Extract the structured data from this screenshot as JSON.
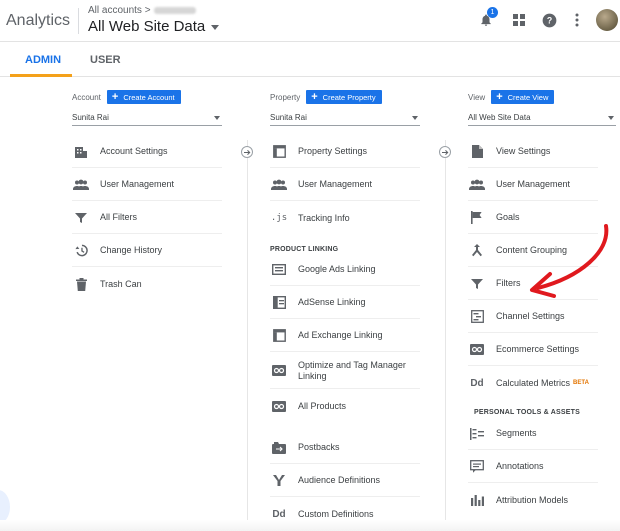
{
  "header": {
    "app_title": "Analytics",
    "breadcrumb": "All accounts >",
    "site_title": "All Web Site Data",
    "notification_count": "1"
  },
  "tabs": [
    {
      "label": "ADMIN",
      "active": true
    },
    {
      "label": "USER",
      "active": false
    }
  ],
  "columns": {
    "account": {
      "label": "Account",
      "create_label": "Create Account",
      "selected": "Sunita Rai",
      "items": [
        {
          "label": "Account Settings",
          "icon": "building-icon"
        },
        {
          "label": "User Management",
          "icon": "users-icon"
        },
        {
          "label": "All Filters",
          "icon": "filter-icon"
        },
        {
          "label": "Change History",
          "icon": "history-icon"
        },
        {
          "label": "Trash Can",
          "icon": "trash-icon"
        }
      ]
    },
    "property": {
      "label": "Property",
      "create_label": "Create Property",
      "selected": "Sunita Rai",
      "items": [
        {
          "label": "Property Settings",
          "icon": "window-icon"
        },
        {
          "label": "User Management",
          "icon": "users-icon"
        },
        {
          "label": "Tracking Info",
          "icon": "js-icon"
        }
      ],
      "section_title": "PRODUCT LINKING",
      "linking_items": [
        {
          "label": "Google Ads Linking",
          "icon": "ads-icon"
        },
        {
          "label": "AdSense Linking",
          "icon": "adsense-icon"
        },
        {
          "label": "Ad Exchange Linking",
          "icon": "window-icon"
        },
        {
          "label": "Optimize and Tag Manager Linking",
          "icon": "link-icon"
        },
        {
          "label": "All Products",
          "icon": "link-icon"
        }
      ],
      "bottom_items": [
        {
          "label": "Postbacks",
          "icon": "postback-icon"
        },
        {
          "label": "Audience Definitions",
          "icon": "audience-icon"
        },
        {
          "label": "Custom Definitions",
          "icon": "dd-icon"
        }
      ]
    },
    "view": {
      "label": "View",
      "create_label": "Create View",
      "selected": "All Web Site Data",
      "items": [
        {
          "label": "View Settings",
          "icon": "document-icon"
        },
        {
          "label": "User Management",
          "icon": "users-icon"
        },
        {
          "label": "Goals",
          "icon": "flag-icon"
        },
        {
          "label": "Content Grouping",
          "icon": "grouping-icon"
        },
        {
          "label": "Filters",
          "icon": "filter-icon"
        },
        {
          "label": "Channel Settings",
          "icon": "channel-icon"
        },
        {
          "label": "Ecommerce Settings",
          "icon": "cart-icon"
        },
        {
          "label": "Calculated Metrics",
          "icon": "dd-icon",
          "badge": "BETA"
        }
      ],
      "section_title": "PERSONAL TOOLS & ASSETS",
      "tool_items": [
        {
          "label": "Segments",
          "icon": "segments-icon"
        },
        {
          "label": "Annotations",
          "icon": "annotation-icon"
        },
        {
          "label": "Attribution Models",
          "icon": "bars-icon"
        }
      ]
    }
  },
  "colors": {
    "accent": "#1a73e8",
    "tab_underline": "#f4a11a",
    "annotation_arrow": "#e0191e"
  }
}
